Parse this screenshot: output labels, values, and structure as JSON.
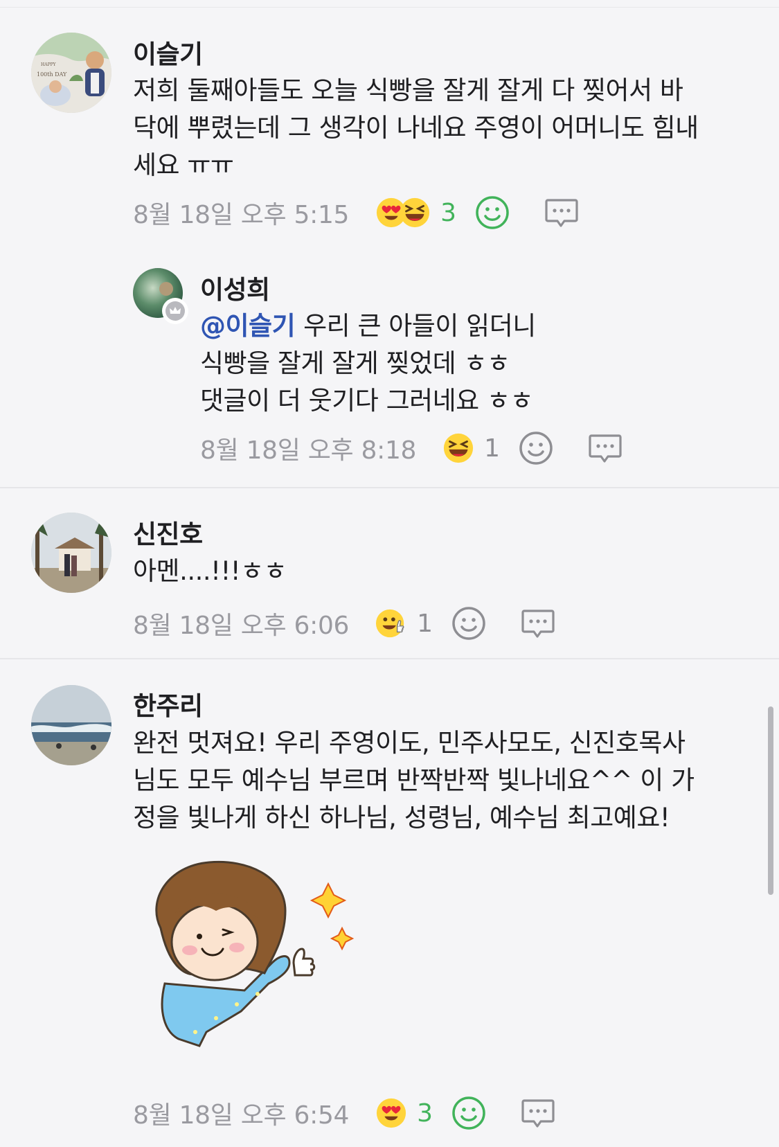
{
  "comments": [
    {
      "author": "이슬기",
      "text_lines": [
        "저희 둘째아들도 오늘 식빵을 잘게 잘게 다 찢어서 바",
        "닥에 뿌렸는데 그 생각이 나네요 주영이 어머니도 힘내",
        "세요 ㅠㅠ"
      ],
      "time": "8월 18일 오후 5:15",
      "reaction_count": "3",
      "reactions": [
        "heart-eyes-emoji",
        "laughing-emoji"
      ],
      "avatar_caption": "100th DAY",
      "avatar_small": "HAPPY"
    },
    {
      "author": "이성희",
      "mention": "@이슬기",
      "text_lines": [
        "우리 큰 아들이 읽더니",
        "식빵을 잘게 잘게 찢었데 ㅎㅎ",
        "댓글이 더 웃기다 그러네요 ㅎㅎ"
      ],
      "time": "8월 18일 오후 8:18",
      "reaction_count": "1",
      "reactions": [
        "laughing-emoji"
      ]
    },
    {
      "author": "신진호",
      "text_lines": [
        "아멘....!!!ㅎㅎ"
      ],
      "time": "8월 18일 오후 6:06",
      "reaction_count": "1",
      "reactions": [
        "thumbs-up-emoji"
      ]
    },
    {
      "author": "한주리",
      "text_lines": [
        "완전 멋져요! 우리 주영이도, 민주사모도, 신진호목사",
        "님도 모두 예수님 부르며 반짝반짝 빛나네요^^ 이 가",
        "정을 빛나게 하신 하나님, 성령님, 예수님 최고예요!"
      ],
      "time": "8월 18일 오후 6:54",
      "reaction_count": "3",
      "reactions": [
        "heart-eyes-emoji"
      ]
    }
  ],
  "colors": {
    "background": "#f5f5f7",
    "reaction_count_active": "#41b35a",
    "mention": "#2f55b3",
    "timestamp": "#9a9aa0"
  }
}
